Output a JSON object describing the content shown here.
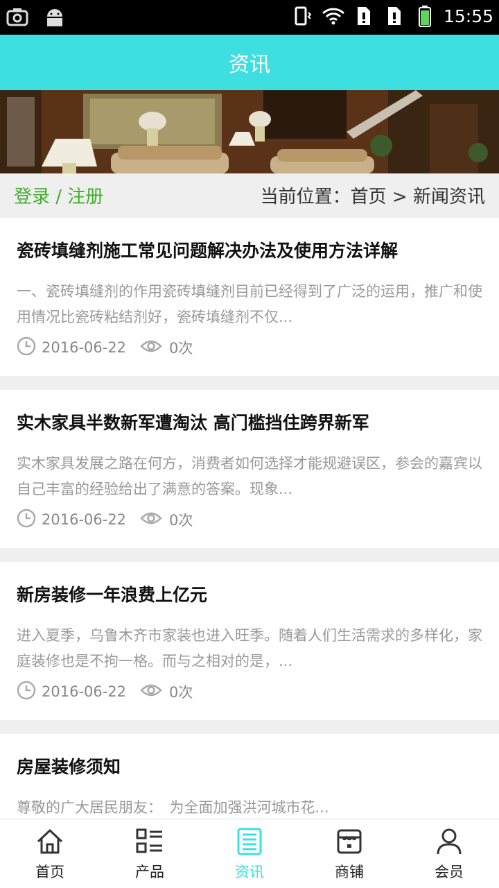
{
  "status_bar": {
    "time": "15:55",
    "icons": [
      "screenshot-icon",
      "android-icon",
      "vibrate-icon",
      "wifi-icon",
      "sim-alert-icon",
      "sim-alert-icon",
      "battery-icon"
    ]
  },
  "header": {
    "title": "资讯"
  },
  "location_bar": {
    "login": "登录 / 注册",
    "breadcrumb": "当前位置：首页 > 新闻资讯"
  },
  "articles": [
    {
      "title": "瓷砖填缝剂施工常见问题解决办法及使用方法详解",
      "excerpt": "一、瓷砖填缝剂的作用瓷砖填缝剂目前已经得到了广泛的运用，推广和使用情况比瓷砖粘结剂好，瓷砖填缝剂不仅...",
      "date": "2016-06-22",
      "views": "0次"
    },
    {
      "title": "实木家具半数新军遭淘汰 高门槛挡住跨界新军",
      "excerpt": "实木家具发展之路在何方，消费者如何选择才能规避误区，参会的嘉宾以自己丰富的经验给出了满意的答案。现象...",
      "date": "2016-06-22",
      "views": "0次"
    },
    {
      "title": "新房装修一年浪费上亿元",
      "excerpt": "进入夏季，乌鲁木齐市家装也进入旺季。随着人们生活需求的多样化，家庭装修也是不拘一格。而与之相对的是，...",
      "date": "2016-06-22",
      "views": "0次"
    },
    {
      "title": "房屋装修须知",
      "excerpt": "尊敬的广大居民朋友：　为全面加强洪河城市花...",
      "date": "",
      "views": ""
    }
  ],
  "nav": {
    "items": [
      {
        "label": "首页",
        "icon": "home-icon"
      },
      {
        "label": "产品",
        "icon": "list-icon"
      },
      {
        "label": "资讯",
        "icon": "news-icon",
        "active": true
      },
      {
        "label": "商铺",
        "icon": "store-icon"
      },
      {
        "label": "会员",
        "icon": "user-icon"
      }
    ],
    "active_color": "#3ddfe0"
  },
  "colors": {
    "header_bg": "#3ddfe0",
    "login_link": "#3fae2a"
  }
}
